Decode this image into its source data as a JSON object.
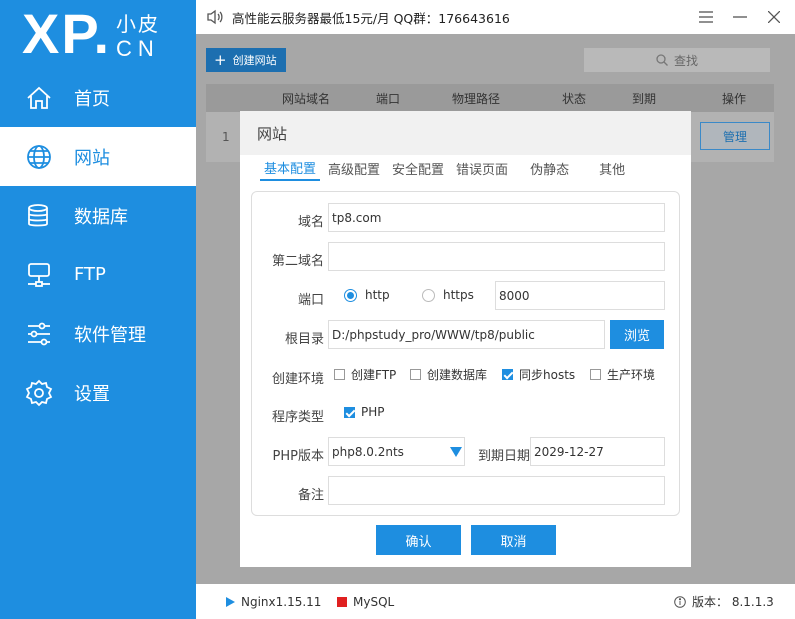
{
  "logo": {
    "main": "XP.",
    "cn_top": "小皮",
    "cn_bottom": "CN"
  },
  "sidebar": {
    "items": [
      {
        "label": "首页",
        "icon": "home-icon",
        "active": false
      },
      {
        "label": "网站",
        "icon": "globe-icon",
        "active": true
      },
      {
        "label": "数据库",
        "icon": "database-icon",
        "active": false
      },
      {
        "label": "FTP",
        "icon": "ftp-server-icon",
        "active": false
      },
      {
        "label": "软件管理",
        "icon": "sliders-icon",
        "active": false
      },
      {
        "label": "设置",
        "icon": "gear-icon",
        "active": false
      }
    ]
  },
  "topbar": {
    "notice": "高性能云服务器最低15元/月   QQ群：176643616",
    "buttons": [
      "menu-icon",
      "minimize-icon",
      "close-icon"
    ]
  },
  "main": {
    "create_button": "创建网站",
    "search_placeholder": "查找",
    "table_headers": [
      "网站域名",
      "端口",
      "物理路径",
      "状态",
      "到期",
      "操作"
    ],
    "row": {
      "index": "1",
      "action": "管理"
    }
  },
  "dialog": {
    "title": "网站",
    "tabs": [
      "基本配置",
      "高级配置",
      "安全配置",
      "错误页面",
      "伪静态",
      "其他"
    ],
    "form": {
      "domain_label": "域名",
      "domain_value": "tp8.com",
      "second_domain_label": "第二域名",
      "second_domain_value": "",
      "port_label": "端口",
      "http_label": "http",
      "https_label": "https",
      "port_value": "8000",
      "root_label": "根目录",
      "root_value": "D:/phpstudy_pro/WWW/tp8/public",
      "browse_label": "浏览",
      "env_label": "创建环境",
      "env_options": [
        {
          "label": "创建FTP",
          "checked": false
        },
        {
          "label": "创建数据库",
          "checked": false
        },
        {
          "label": "同步hosts",
          "checked": true
        },
        {
          "label": "生产环境",
          "checked": false
        }
      ],
      "program_type_label": "程序类型",
      "program_type_option": "PHP",
      "php_version_label": "PHP版本",
      "php_version_value": "php8.0.2nts",
      "expire_label": "到期日期",
      "expire_value": "2029-12-27",
      "note_label": "备注",
      "note_value": ""
    },
    "confirm_label": "确认",
    "cancel_label": "取消"
  },
  "statusbar": {
    "nginx": "Nginx1.15.11",
    "mysql": "MySQL",
    "version": "版本：  8.1.1.3"
  },
  "colors": {
    "accent": "#1e8ee0",
    "mysql_stopped": "#e02020"
  }
}
